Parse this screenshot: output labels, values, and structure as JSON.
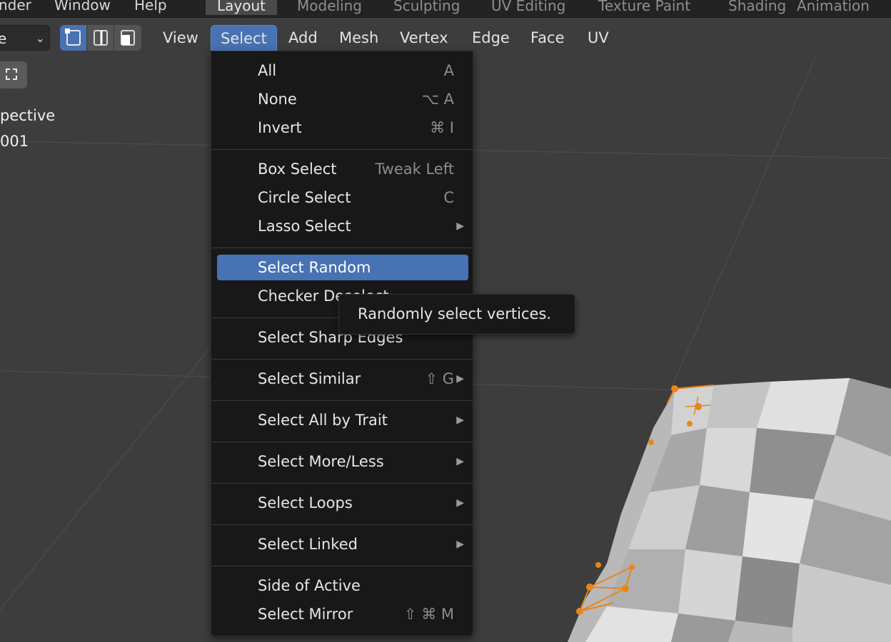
{
  "topbar": {
    "menus": [
      "nder",
      "Window",
      "Help"
    ],
    "workspaces": [
      {
        "label": "Layout",
        "active": true
      },
      {
        "label": "Modeling"
      },
      {
        "label": "Sculpting"
      },
      {
        "label": "UV Editing"
      },
      {
        "label": "Texture Paint"
      },
      {
        "label": "Shading"
      },
      {
        "label": "Animation"
      }
    ]
  },
  "header": {
    "mode_value": "e",
    "menus": [
      "View",
      "Select",
      "Add",
      "Mesh",
      "Vertex",
      "Edge",
      "Face",
      "UV"
    ]
  },
  "viewport": {
    "perspective_label": "pective",
    "object_label": "001"
  },
  "select_menu": {
    "items": [
      {
        "label": "All",
        "shortcut": "A"
      },
      {
        "label": "None",
        "shortcut": "⌥ A"
      },
      {
        "label": "Invert",
        "shortcut": "⌘ I"
      },
      {
        "label": "Box Select",
        "shortcut": "Tweak Left"
      },
      {
        "label": "Circle Select",
        "shortcut": "C"
      },
      {
        "label": "Lasso Select",
        "submenu": true
      },
      {
        "label": "Select Random",
        "highlighted": true
      },
      {
        "label": "Checker Deselect"
      },
      {
        "label": "Select Sharp Edges"
      },
      {
        "label": "Select Similar",
        "shortcut": "⇧ G",
        "submenu": true
      },
      {
        "label": "Select All by Trait",
        "submenu": true
      },
      {
        "label": "Select More/Less",
        "submenu": true
      },
      {
        "label": "Select Loops",
        "submenu": true
      },
      {
        "label": "Select Linked",
        "submenu": true
      },
      {
        "label": "Side of Active"
      },
      {
        "label": "Select Mirror",
        "shortcut": "⇧ ⌘ M"
      }
    ]
  },
  "tooltip": {
    "text": "Randomly select vertices."
  },
  "colors": {
    "accent": "#4772b3",
    "menu_bg": "#181818",
    "viewport_bg": "#3d3d3d",
    "selection": "#e8861a"
  }
}
